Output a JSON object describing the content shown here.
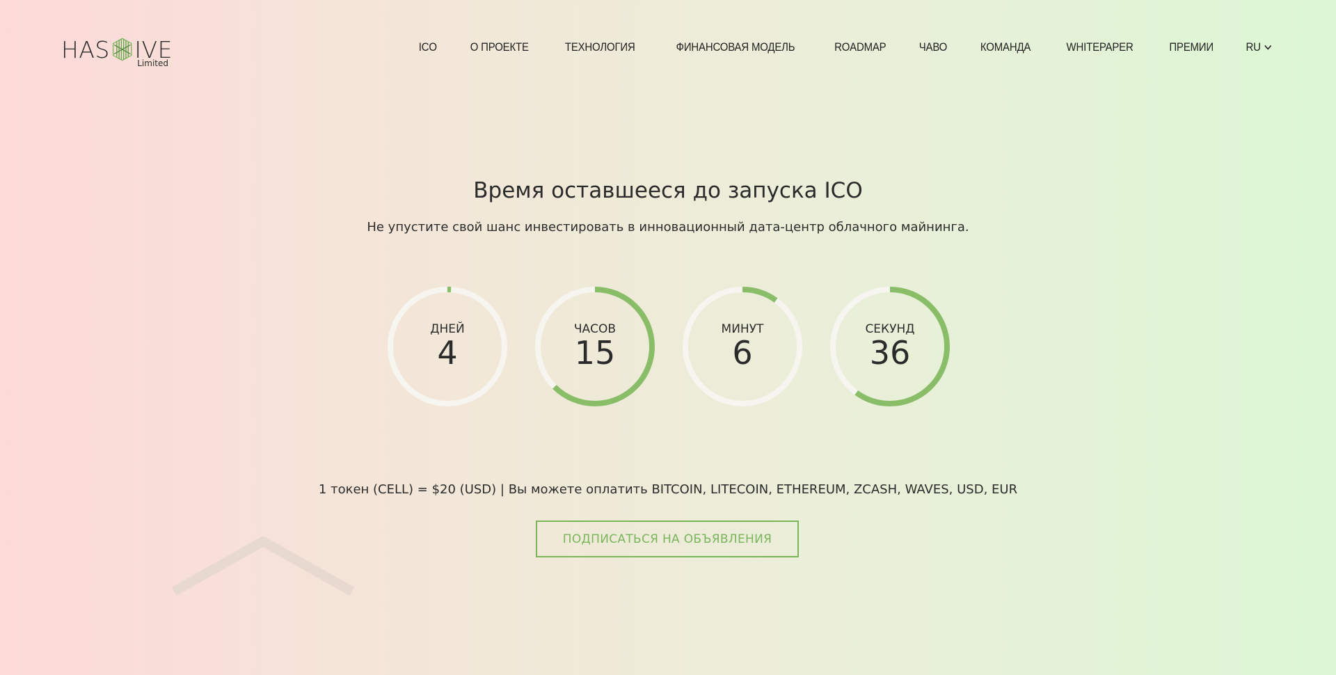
{
  "brand": {
    "name_left": "HAS",
    "name_right": "IVE",
    "sub": "Limited",
    "accent_color": "#7ab55c"
  },
  "nav": {
    "items": [
      {
        "label": "ICO"
      },
      {
        "label": "О ПРОЕКТЕ"
      },
      {
        "label": "ТЕХНОЛОГИЯ"
      },
      {
        "label": "ФИНАНСОВАЯ МОДЕЛЬ"
      },
      {
        "label": "ROADMAP"
      },
      {
        "label": "ЧАВО"
      },
      {
        "label": "КОМАНДА"
      },
      {
        "label": "WHITEPAPER"
      },
      {
        "label": "ПРЕМИИ"
      }
    ],
    "language": "RU",
    "language_icon": "chevron-down-icon"
  },
  "hero": {
    "title": "Время оставшееся до запуска ICO",
    "subtitle": "Не упустите свой шанс инвестировать в инновационный дата-центр облачного майнинга."
  },
  "countdown": [
    {
      "label": "ДНЕЙ",
      "value": "4",
      "progress": 0.01
    },
    {
      "label": "ЧАСОВ",
      "value": "15",
      "progress": 0.625
    },
    {
      "label": "МИНУТ",
      "value": "6",
      "progress": 0.1
    },
    {
      "label": "СЕКУНД",
      "value": "36",
      "progress": 0.6
    }
  ],
  "pricing": {
    "text": "1 токен (CELL) = $20 (USD) | Вы можете оплатить BITCOIN, LITECOIN, ETHEREUM, ZCASH, WAVES, USD, EUR"
  },
  "cta": {
    "subscribe_label": "ПОДПИСАТЬСЯ НА ОБЪЯВЛЕНИЯ"
  },
  "colors": {
    "ring_track": "#f7f5ef",
    "ring_fill": "#8abd67",
    "text": "#2b2b2b"
  }
}
